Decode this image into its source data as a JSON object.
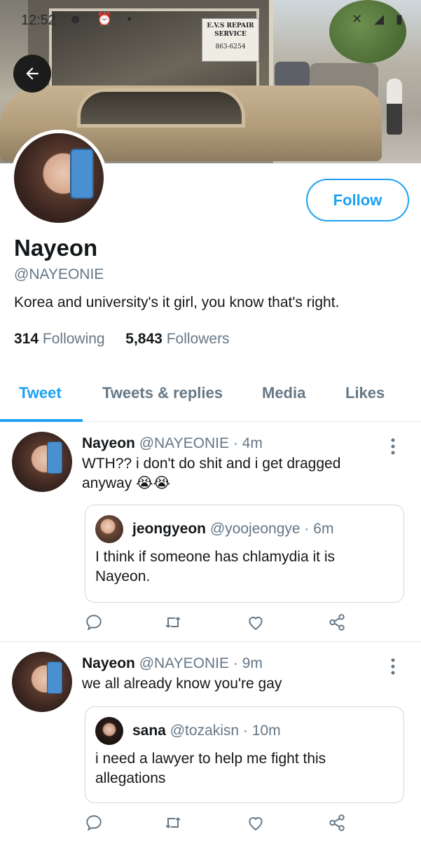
{
  "status_bar": {
    "time": "12:52",
    "left_icons": "☻ ⏰ •",
    "right_icons": "✕ ◢ ▮"
  },
  "banner": {
    "sign_line1": "E.V.S REPAIR",
    "sign_line2": "SERVICE",
    "sign_phone": "863-6254"
  },
  "profile": {
    "name": "Nayeon",
    "handle": "@NAYEONIE",
    "bio": "Korea and university's it girl, you know that's right.",
    "following_count": "314",
    "following_label": "Following",
    "followers_count": "5,843",
    "followers_label": "Followers",
    "follow_button": "Follow"
  },
  "tabs": [
    {
      "label": "Tweet",
      "active": true
    },
    {
      "label": "Tweets & replies",
      "active": false
    },
    {
      "label": "Media",
      "active": false
    },
    {
      "label": "Likes",
      "active": false
    }
  ],
  "tweets": [
    {
      "name": "Nayeon",
      "meta": "@NAYEONIE · 4m",
      "text": "WTH?? i don't do shit and i get dragged anyway 😭😭",
      "quote": {
        "name": "jeongyeon",
        "meta": "@yoojeongye · 6m",
        "text": "I think if someone has chlamydia it is Nayeon."
      }
    },
    {
      "name": "Nayeon",
      "meta": "@NAYEONIE · 9m",
      "text": "we all already know you're gay",
      "quote": {
        "name": "sana",
        "meta": "@tozakisn · 10m",
        "text": "i need a lawyer to help me fight this allegations"
      }
    }
  ],
  "colors": {
    "accent": "#1da1f2",
    "secondary_text": "#657786",
    "primary_text": "#14171a",
    "border": "#e1e8ed"
  },
  "icons": {
    "back": "arrow-left-icon",
    "more": "more-vertical-icon",
    "reply": "reply-icon",
    "retweet": "retweet-icon",
    "like": "heart-icon",
    "share": "share-icon"
  }
}
